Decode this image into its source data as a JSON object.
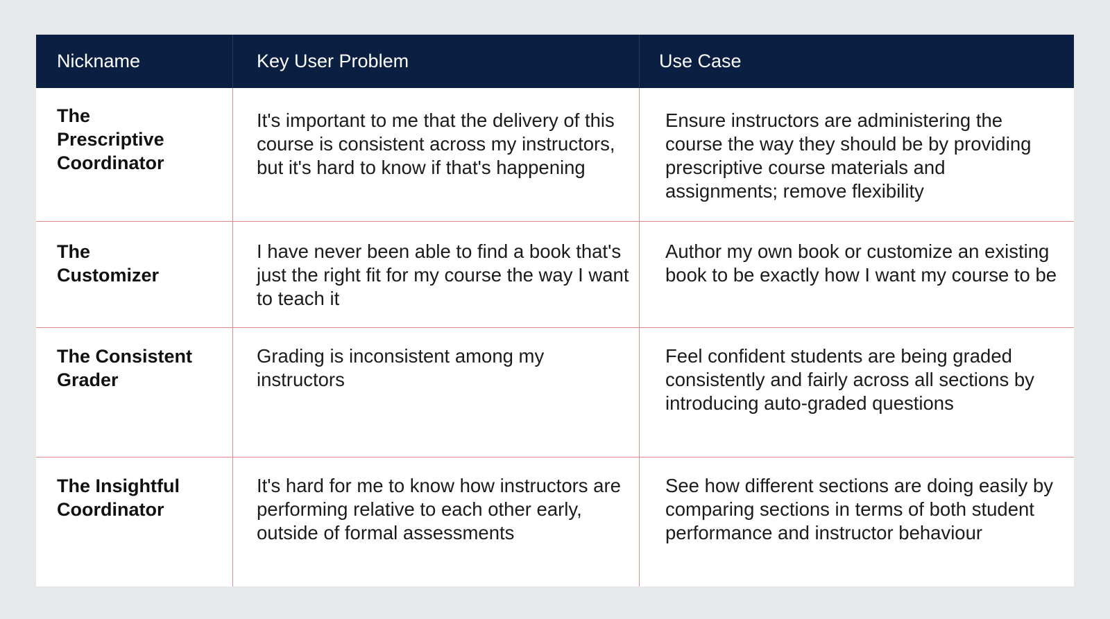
{
  "table": {
    "headers": [
      "Nickname",
      "Key User Problem",
      "Use Case"
    ],
    "rows": [
      {
        "nickname": "The Prescriptive Coordinator",
        "problem": "It's important to me that the delivery of this course is consistent across my instructors, but it's hard to know if that's happening",
        "use_case": "Ensure instructors are administering the course the way they should be by providing prescriptive course materials and assignments; remove flexibility"
      },
      {
        "nickname": "The Customizer",
        "problem": "I have never been able to find a book that's just the right fit for my course the way I want to teach it",
        "use_case": "Author my own book or customize an existing book to be exactly how I want my course to be"
      },
      {
        "nickname": "The Consistent Grader",
        "problem": "Grading is inconsistent among my instructors",
        "use_case": "Feel confident students are being graded consistently and fairly across all sections by introducing auto-graded questions"
      },
      {
        "nickname": "The Insightful Coordinator",
        "problem": "It's hard for me to know how instructors are performing relative to each other early, outside of formal assessments",
        "use_case": "See how different sections are doing easily by comparing sections in terms of both student performance and instructor behaviour"
      }
    ]
  },
  "colors": {
    "header_bg": "#0b1f42",
    "border": "#e08a8a",
    "page_bg": "#e7e8ea"
  }
}
